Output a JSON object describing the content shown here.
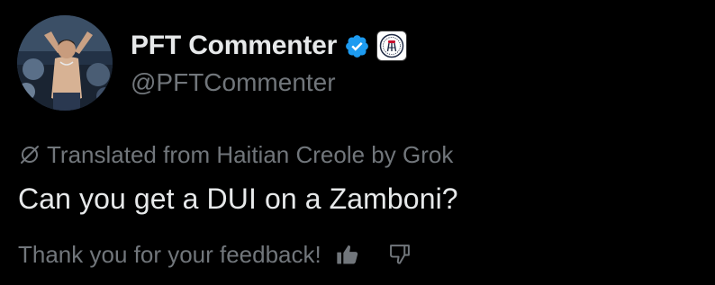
{
  "author": {
    "display_name": "PFT Commenter",
    "handle": "@PFTCommenter",
    "avatar_icon": "profile-photo",
    "verified_icon": "verified-badge-icon",
    "affiliate_icon": "barstool-affiliate-badge-icon"
  },
  "translation": {
    "label": "Translated from Haitian Creole by Grok",
    "icon": "translate-icon"
  },
  "post": {
    "text": "Can you get a DUI on a Zamboni?"
  },
  "feedback": {
    "label": "Thank you for your feedback!",
    "thumbs_up_icon": "thumbs-up-icon",
    "thumbs_down_icon": "thumbs-down-icon",
    "thumbs_up_selected": true
  },
  "colors": {
    "background": "#000000",
    "primary_text": "#e7e9ea",
    "secondary_text": "#71767b",
    "verified_blue": "#1d9bf0"
  }
}
